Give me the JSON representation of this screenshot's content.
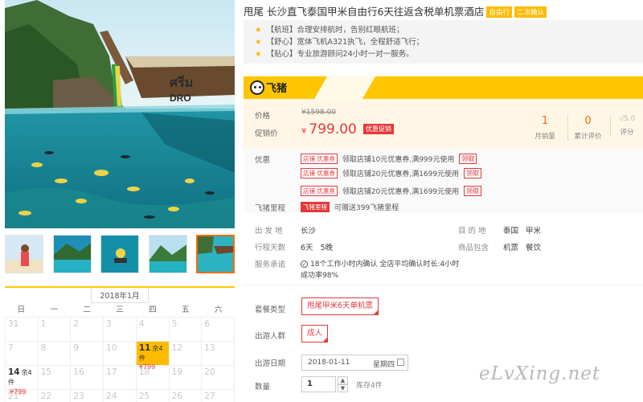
{
  "product": {
    "title": "甩尾 长沙直飞泰国甲米自由行6天往返含税单机票酒店",
    "tags": [
      "自由行",
      "二次确认"
    ]
  },
  "features": [
    {
      "icon": "star-icon",
      "text": "【航班】合理安排航时，告别红眼航班；"
    },
    {
      "icon": "star-icon",
      "text": "【舒心】宽体飞机A321执飞，全程舒适飞行；"
    },
    {
      "icon": "star-icon",
      "text": "【贴心】专业旅游顾问24小时一对一服务。"
    }
  ],
  "brand": {
    "name": "飞猪",
    "color": "#ffc500"
  },
  "price": {
    "orig_label": "价格",
    "orig_value": "¥1598.00",
    "now_label": "促销价",
    "currency": "¥",
    "now_value": "799.00",
    "promo_tag": "优惠促销"
  },
  "stats": [
    {
      "value": "1",
      "label": "月销量"
    },
    {
      "value": "0",
      "label": "累计评价"
    },
    {
      "value": "-/5.0",
      "label": "评分"
    }
  ],
  "coupons": {
    "label": "优惠",
    "badge": "店铺 优惠券",
    "get_label": "领取",
    "items": [
      "领取店铺10元优惠券,满999元使用",
      "领取店铺20元优惠券,满1699元使用",
      "领取店铺20元优惠券,满1699元使用"
    ],
    "miles_label": "飞猪里程",
    "miles_badge": "飞猪里程",
    "miles_text": "可赠送399飞猪里程"
  },
  "trip": {
    "from_label": "出 发 地",
    "from": "长沙",
    "dest_label": "目 的 地",
    "dest": "泰国   甲米",
    "days_label": "行程天数",
    "days": "6天   5晚",
    "includes_label": "商品包含",
    "includes": "机票   餐饮",
    "service_label": "服务承诺",
    "service_line1": "18个工作小时内确认 全店平均确认时长:4小时",
    "service_line2": "成功率98%"
  },
  "options": {
    "package_label": "套餐类型",
    "package_value": "甩尾甲米6天单机票",
    "group_label": "出游人群",
    "group_value": "成人",
    "date_label": "出游日期",
    "date_value": "2018-01-11",
    "date_weekday": "星期四",
    "qty_label": "数量",
    "qty_value": "1",
    "stock": "库存4件"
  },
  "calendar": {
    "month": "2018年1月",
    "weekdays": [
      "日",
      "一",
      "二",
      "三",
      "四",
      "五",
      "六"
    ],
    "rows": [
      [
        "31",
        "1",
        "2",
        "3",
        "4",
        "5",
        "6"
      ],
      [
        "7",
        "8",
        "9",
        "10",
        "11",
        "12",
        "13"
      ],
      [
        "14",
        "15",
        "16",
        "17",
        "18",
        "19",
        "20"
      ],
      [
        "21",
        "22",
        "23",
        "24",
        "25",
        "26",
        "27"
      ]
    ],
    "avail": [
      {
        "day": "11",
        "stock": "余4件",
        "price": "¥799"
      },
      {
        "day": "14",
        "stock": "余4件",
        "price": "¥799"
      }
    ]
  },
  "watermark": "eLvXing.net"
}
